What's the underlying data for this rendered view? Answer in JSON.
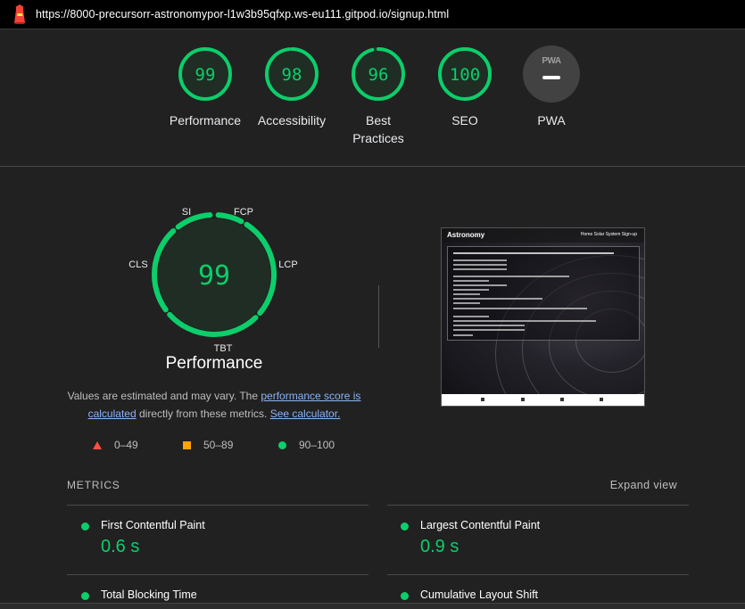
{
  "header": {
    "url": "https://8000-precursorr-astronomypor-l1w3b95qfxp.ws-eu111.gitpod.io/signup.html",
    "logo_icon": "lighthouse-icon"
  },
  "scores": [
    {
      "value": "99",
      "label": "Performance",
      "score": 0.99
    },
    {
      "value": "98",
      "label": "Accessibility",
      "score": 0.98
    },
    {
      "value": "96",
      "label": "Best Practices",
      "score": 0.96
    },
    {
      "value": "100",
      "label": "SEO",
      "score": 1.0
    },
    {
      "pwa_badge": "PWA",
      "label": "PWA"
    }
  ],
  "performance": {
    "score": "99",
    "title": "Performance",
    "segments": [
      "SI",
      "FCP",
      "LCP",
      "TBT",
      "CLS"
    ],
    "notice_pre": "Values are estimated and may vary. The ",
    "notice_link1": "performance score is calculated",
    "notice_mid": " directly from these metrics. ",
    "notice_link2": "See calculator."
  },
  "legend": [
    {
      "icon": "red-triangle-icon",
      "range": "0–49"
    },
    {
      "icon": "orange-square-icon",
      "range": "50–89"
    },
    {
      "icon": "green-circle-icon",
      "range": "90–100"
    }
  ],
  "screenshot": {
    "brand": "Astronomy",
    "nav_links": "Home  Solar System  Sign-up"
  },
  "metrics": {
    "heading": "METRICS",
    "expand_label": "Expand view",
    "items": [
      {
        "title": "First Contentful Paint",
        "value": "0.6 s"
      },
      {
        "title": "Largest Contentful Paint",
        "value": "0.9 s"
      },
      {
        "title": "Total Blocking Time",
        "value": ""
      },
      {
        "title": "Cumulative Layout Shift",
        "value": ""
      }
    ]
  },
  "colors": {
    "pass": "#0cce6b",
    "average": "#ffa400",
    "fail": "#ff4e42",
    "link": "#8ab4f8"
  }
}
